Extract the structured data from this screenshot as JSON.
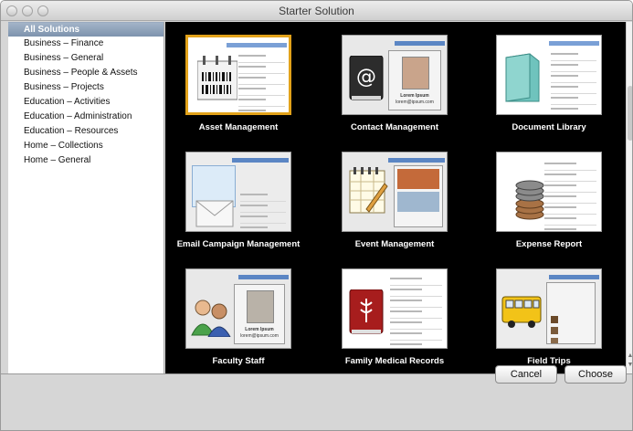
{
  "window": {
    "title": "Starter Solution"
  },
  "sidebar": {
    "items": [
      {
        "label": "All Solutions",
        "selected": true
      },
      {
        "label": "Business – Finance",
        "selected": false
      },
      {
        "label": "Business – General",
        "selected": false
      },
      {
        "label": "Business – People & Assets",
        "selected": false
      },
      {
        "label": "Business – Projects",
        "selected": false
      },
      {
        "label": "Education – Activities",
        "selected": false
      },
      {
        "label": "Education – Administration",
        "selected": false
      },
      {
        "label": "Education – Resources",
        "selected": false
      },
      {
        "label": "Home – Collections",
        "selected": false
      },
      {
        "label": "Home – General",
        "selected": false
      }
    ]
  },
  "gallery": {
    "tiles": [
      {
        "label": "Asset Management",
        "icon": "barcode-icon",
        "selected": true
      },
      {
        "label": "Contact Management",
        "icon": "at-sign-book-icon",
        "selected": false,
        "card_name": "Lorem Ipsum",
        "card_email": "lorem@ipsum.com"
      },
      {
        "label": "Document Library",
        "icon": "folder-icon",
        "selected": false
      },
      {
        "label": "Email Campaign Management",
        "icon": "envelope-icon",
        "selected": false
      },
      {
        "label": "Event Management",
        "icon": "calendar-icon",
        "selected": false
      },
      {
        "label": "Expense Report",
        "icon": "coins-icon",
        "selected": false
      },
      {
        "label": "Faculty Staff",
        "icon": "people-icon",
        "selected": false,
        "card_name": "Lorem Ipsum",
        "card_email": "lorem@ipsum.com"
      },
      {
        "label": "Family Medical Records",
        "icon": "medical-book-icon",
        "selected": false
      },
      {
        "label": "Field Trips",
        "icon": "school-bus-icon",
        "selected": false
      }
    ]
  },
  "buttons": {
    "cancel": "Cancel",
    "choose": "Choose"
  },
  "colors": {
    "selection_highlight": "#e2a21a",
    "sidebar_selection": "#8a9fb8",
    "gallery_background": "#000000"
  }
}
